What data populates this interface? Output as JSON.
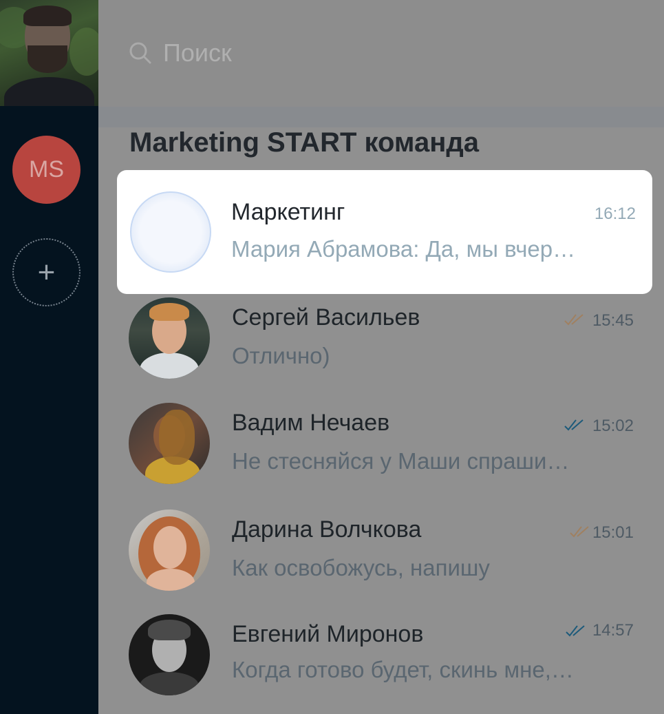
{
  "search": {
    "placeholder": "Поиск"
  },
  "rail": {
    "workspace_initials": "MS",
    "add_symbol": "+"
  },
  "team": {
    "title": "Marketing START команда"
  },
  "chats": [
    {
      "name": "Маркетинг",
      "preview": "Мария Абрамова: Да, мы вчер…",
      "time": "16:12",
      "active": true,
      "read_status": "none"
    },
    {
      "name": "Сергей Васильев",
      "preview": "Отлично)",
      "time": "15:45",
      "active": false,
      "read_status": "sent",
      "check_color": "#a08060"
    },
    {
      "name": "Вадим Нечаев",
      "preview": "Не стесняйся у Маши спраши…",
      "time": "15:02",
      "active": false,
      "read_status": "read",
      "check_color": "#1c5a7a"
    },
    {
      "name": "Дарина Волчкова",
      "preview": "Как освобожусь, напишу",
      "time": "15:01",
      "active": false,
      "read_status": "sent",
      "check_color": "#a08060"
    },
    {
      "name": "Евгений Миронов",
      "preview": "Когда готово будет, скинь мне,…",
      "time": "14:57",
      "active": false,
      "read_status": "read",
      "check_color": "#1c5a7a"
    }
  ],
  "colors": {
    "rail_bg": "#04131f",
    "workspace_avatar": "#b8453f",
    "active_item_bg": "#ffffff",
    "preview_active": "#93a9b6"
  }
}
